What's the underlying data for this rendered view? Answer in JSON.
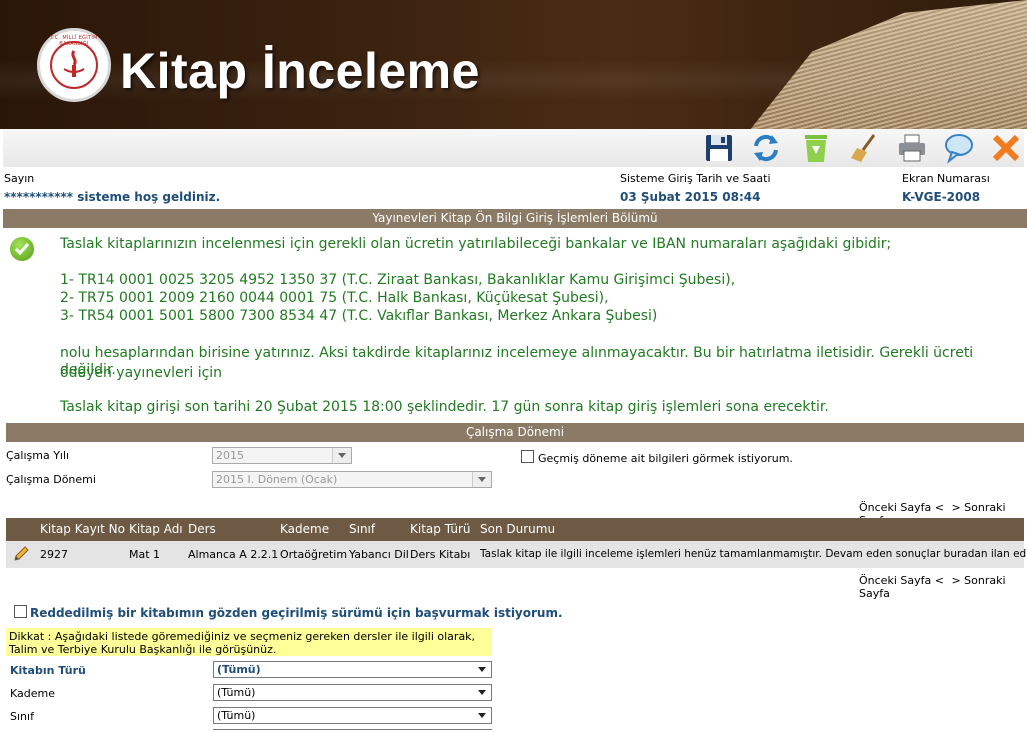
{
  "header": {
    "title": "Kitap İnceleme",
    "logo_text": "T.C. MİLLÎ EĞİTİM BAKANLIĞI"
  },
  "toolbar": {
    "buttons": [
      "save-icon",
      "refresh-icon",
      "recycle-icon",
      "broom-icon",
      "print-icon",
      "comment-icon",
      "close-icon"
    ]
  },
  "info": {
    "sayin_label": "Sayın",
    "welcome_text": "*********** sisteme hoş geldiniz.",
    "login_label": "Sisteme Giriş Tarih ve Saati",
    "login_value": "03 Şubat 2015 08:44",
    "screen_label": "Ekran Numarası",
    "screen_value": "K-VGE-2008"
  },
  "section_title": "Yayınevleri Kitap Ön Bilgi Giriş İşlemleri Bölümü",
  "notice": {
    "intro": "Taslak kitaplarınızın incelenmesi için gerekli olan ücretin yatırılabileceği bankalar ve IBAN numaraları aşağıdaki gibidir;",
    "iban1": "1- TR14 0001 0025 3205 4952 1350 37 (T.C. Ziraat Bankası, Bakanlıklar Kamu Girişimci Şubesi),",
    "iban2": "2- TR75 0001 2009 2160 0044 0001 75 (T.C. Halk Bankası, Küçükesat Şubesi),",
    "iban3": "3- TR54 0001 5001 5800 7300 8534 47 (T.C. Vakıflar Bankası, Merkez Ankara Şubesi)",
    "para2_line1": "nolu hesaplarından birisine yatırınız. Aksi takdirde kitaplarınız incelemeye alınmayacaktır. Bu bir hatırlatma iletisidir. Gerekli ücreti ödeyen yayınevleri için",
    "para2_line2": "değildir.",
    "deadline": "Taslak kitap girişi son tarihi 20 Şubat 2015 18:00 şeklindedir. 17 gün sonra kitap giriş işlemleri sona erecektir."
  },
  "period": {
    "title": "Çalışma Dönemi",
    "year_label": "Çalışma Yılı",
    "year_value": "2015",
    "term_label": "Çalışma Dönemi",
    "term_value": "2015 I. Dönem (Ocak)",
    "past_checkbox_label": "Geçmiş döneme ait bilgileri görmek istiyorum."
  },
  "pager": {
    "prev": "Önceki Sayfa <",
    "next": "> Sonraki Sayfa"
  },
  "table": {
    "columns": [
      "Kitap Kayıt No",
      "Kitap Adı",
      "Ders",
      "Kademe",
      "Sınıf",
      "Kitap Türü",
      "Son Durumu"
    ],
    "rows": [
      [
        "2927",
        "Mat 1",
        "Almanca A 2.2.1",
        "Ortaöğretim",
        "Yabancı Dil",
        "Ders Kitabı",
        "Taslak kitap ile ilgili inceleme işlemleri henüz tamamlanmamıştır. Devam eden sonuçlar buradan ilan edilecektir."
      ]
    ]
  },
  "rejected": {
    "checkbox_label": "Reddedilmiş bir kitabımın gözden geçirilmiş sürümü için başvurmak istiyorum.",
    "warning": "Dikkat : Aşağıdaki listede göremediğiniz ve seçmeniz gereken dersler ile ilgili olarak, Talim ve Terbiye Kurulu Başkanlığı ile görüşünüz.",
    "type_label": "Kitabın Türü",
    "type_value": "(Tümü)",
    "level_label": "Kademe",
    "level_value": "(Tümü)",
    "class_label": "Sınıf",
    "class_value": "(Tümü)"
  },
  "colors": {
    "bar": "#8b7a65",
    "table_header": "#6e5a44",
    "notice_text": "#227a22",
    "info_value": "#1f4e79",
    "warning_bg": "#ffff99"
  }
}
